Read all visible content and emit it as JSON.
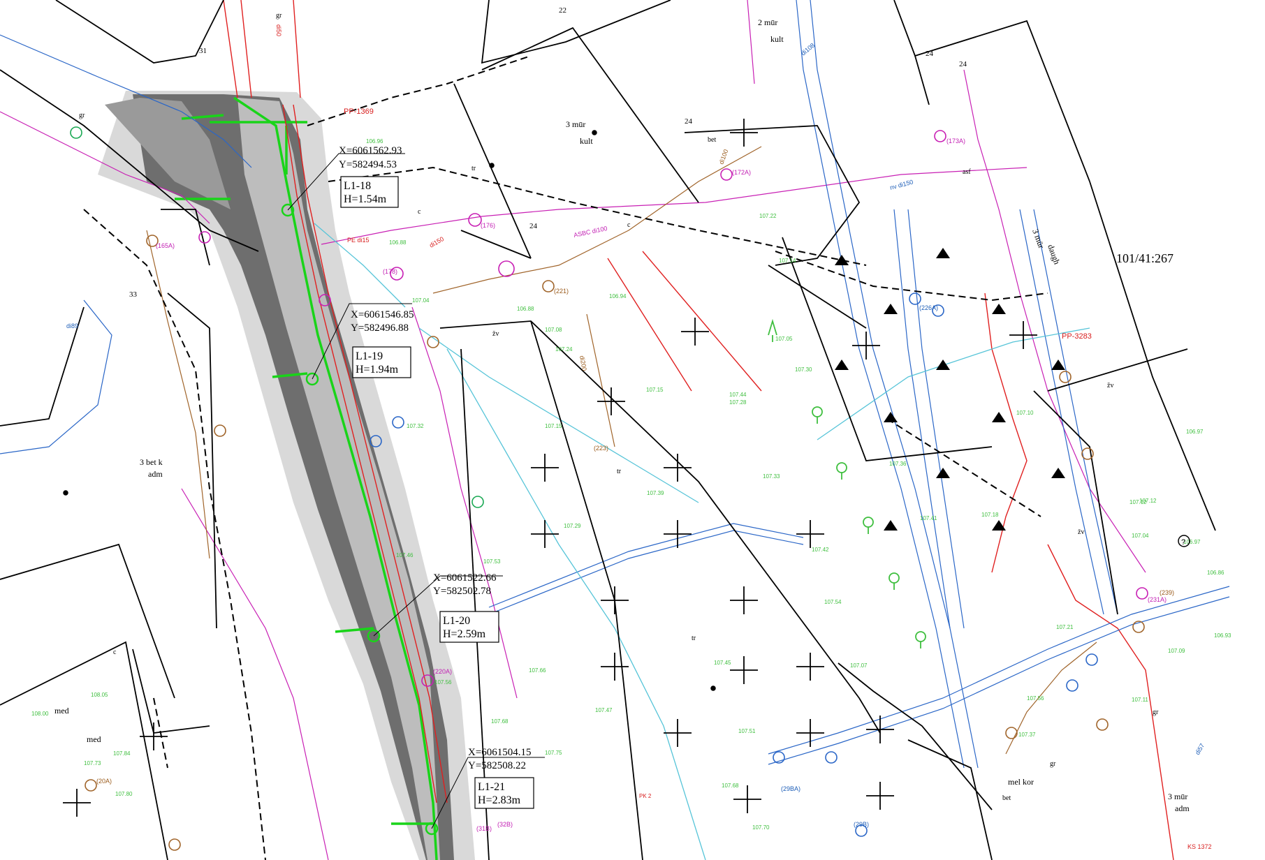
{
  "parcel": {
    "id": "101/41:267"
  },
  "buildings": [
    {
      "label": "3 mūr",
      "sub": "kult"
    },
    {
      "label": "2 mūr",
      "sub": "kult"
    },
    {
      "label": "3 mūr",
      "sub": "daugh"
    },
    {
      "label": "3 bet k",
      "sub": "adm"
    },
    {
      "label": "3 mūr",
      "sub": "adm"
    },
    {
      "label": "med",
      "sub": ""
    },
    {
      "label": "med",
      "sub": ""
    },
    {
      "label": "mel kor",
      "sub": ""
    }
  ],
  "house_numbers": [
    "31",
    "33",
    "22",
    "24",
    "24",
    "24",
    "24"
  ],
  "surface_codes": [
    "tr",
    "tr",
    "tr",
    "c",
    "c",
    "c",
    "gr",
    "gr",
    "gr",
    "gr",
    "asf",
    "bet",
    "bet",
    "žv",
    "žv",
    "žv"
  ],
  "survey_points": [
    {
      "id": "L1-18",
      "x": "X=6061562.93",
      "y": "Y=582494.53",
      "h": "H=1.54m"
    },
    {
      "id": "L1-19",
      "x": "X=6061546.85",
      "y": "Y=582496.88",
      "h": "H=1.94m"
    },
    {
      "id": "L1-20",
      "x": "X=6061522.66",
      "y": "Y=582502.78",
      "h": "H=2.59m"
    },
    {
      "id": "L1-21",
      "x": "X=6061504.15",
      "y": "Y=582508.22",
      "h": "H=2.83m"
    }
  ],
  "pole_labels": [
    "PP-1369",
    "PP-3283",
    "KS 1372",
    "PK 2"
  ],
  "pipe_labels": [
    "PE di15",
    "ASBC di100",
    "nv di150",
    "di89",
    "di50",
    "di200",
    "di108",
    "di57",
    "di100",
    "di150"
  ],
  "well_labels": [
    "(178)",
    "(176)",
    "(173A)",
    "(172A)",
    "(165A)",
    "(220A)",
    "(223)",
    "(231A)",
    "(239)",
    "(20A)",
    "(29BA)",
    "(29B)",
    "(31B)",
    "(32B)",
    "(226A)",
    "(221)"
  ],
  "elevations": [
    "106.96",
    "106.88",
    "107.04",
    "107.15",
    "107.15",
    "107.39",
    "107.29",
    "107.45",
    "107.51",
    "107.68",
    "107.70",
    "107.30",
    "107.05",
    "107.14",
    "107.36",
    "107.41",
    "107.18",
    "107.12",
    "107.10",
    "106.97",
    "106.86",
    "107.21",
    "107.53",
    "107.66",
    "107.68",
    "107.32",
    "107.46",
    "107.47",
    "107.56",
    "107.75",
    "108.05",
    "108.00",
    "107.84",
    "107.80",
    "107.73",
    "107.56",
    "107.37",
    "107.44",
    "107.54",
    "107.07",
    "107.08",
    "107.24",
    "107.28",
    "107.33",
    "107.42",
    "106.97",
    "106.93",
    "107.09",
    "107.11",
    "107.12",
    "107.04",
    "106.88",
    "106.94",
    "107.22"
  ],
  "colors": {
    "green_line": "#19d419",
    "red_line": "#e02020",
    "magenta_line": "#c81fb4",
    "blue_line": "#2a66c7",
    "cyan_line": "#56c4d8",
    "brown_line": "#a0642a",
    "pavement": "#6e6e6e",
    "cobble": "#cfcfcf",
    "text_green": "#3fbf3f"
  }
}
